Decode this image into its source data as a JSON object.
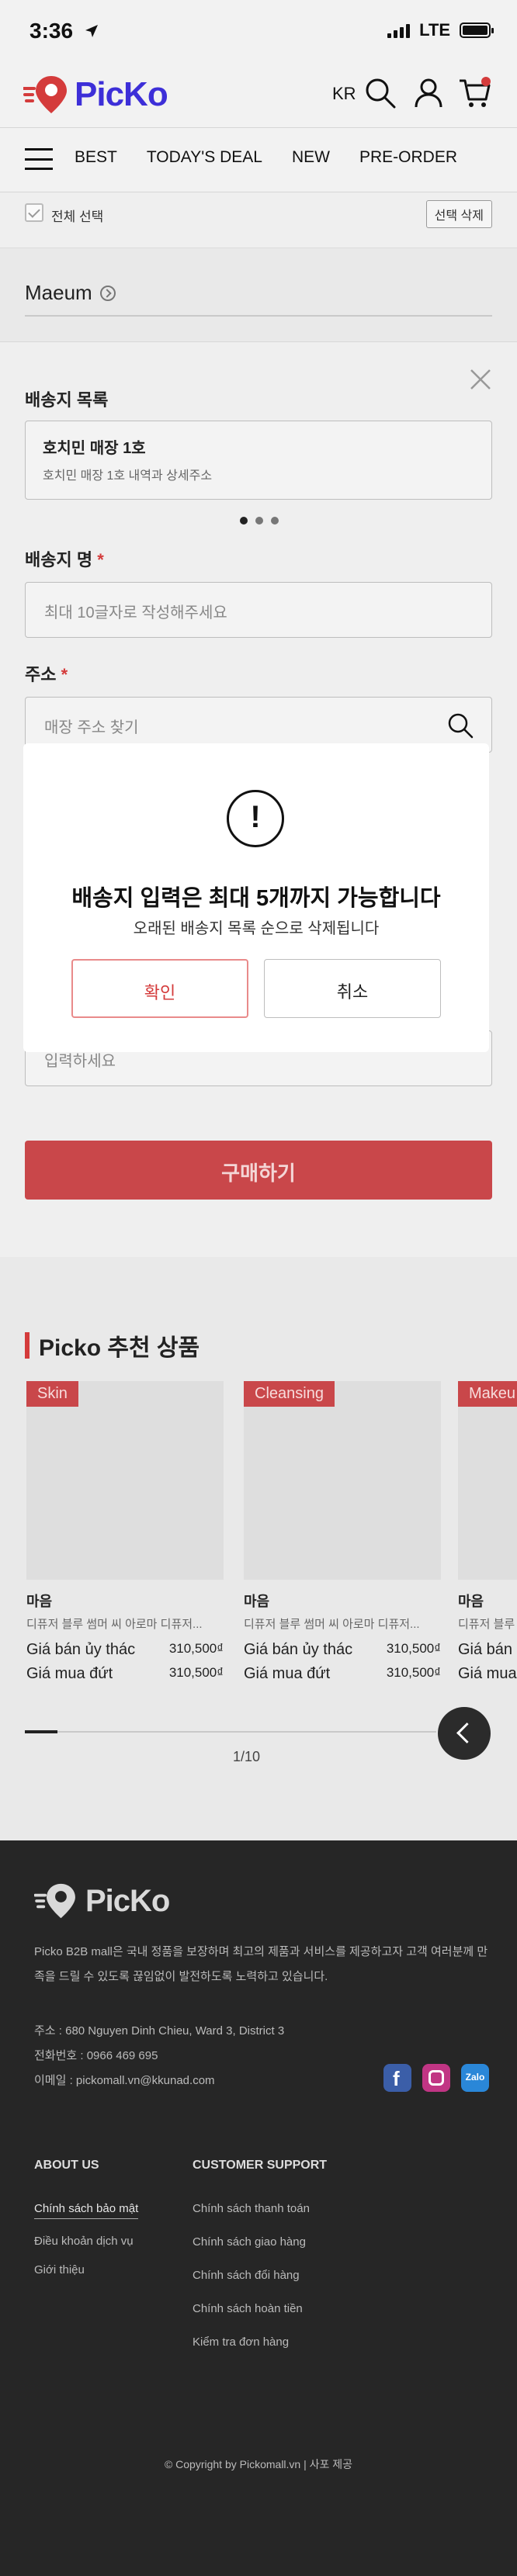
{
  "status_bar": {
    "time": "3:36",
    "network": "LTE"
  },
  "header": {
    "logo_text": "PicKo",
    "lang": "KR",
    "cart_badge": ""
  },
  "nav": {
    "tabs": [
      "BEST",
      "TODAY'S DEAL",
      "NEW",
      "PRE-ORDER"
    ]
  },
  "select_bar": {
    "select_all": "전체 선택",
    "delete_selected": "선택 삭제"
  },
  "store": {
    "name": "Maeum"
  },
  "sheet": {
    "address_list_label": "배송지 목록",
    "card": {
      "title": "호치민 매장 1호",
      "detail": "호치민 매장 1호 내역과 상세주소"
    },
    "name_label": "배송지 명",
    "name_placeholder": "최대 10글자로 작성해주세요",
    "address_label": "주소",
    "address_placeholder": "매장 주소 찾기",
    "extra_placeholder": "입력하세요",
    "buy_label": "구매하기"
  },
  "recommend": {
    "title": "Picko 추천 상품",
    "items": [
      {
        "tag": "Skin",
        "brand": "마음",
        "desc": "디퓨저 블루 썸머 씨 아로마 디퓨저...",
        "price_label": "Giá bán ủy thác",
        "price": "310,500₫",
        "buy_label": "Giá mua đứt",
        "buy_price": "310,500₫"
      },
      {
        "tag": "Cleansing",
        "brand": "마음",
        "desc": "디퓨저 블루 썸머 씨 아로마 디퓨저...",
        "price_label": "Giá bán ủy thác",
        "price": "310,500₫",
        "buy_label": "Giá mua đứt",
        "buy_price": "310,500₫"
      },
      {
        "tag": "Makeu",
        "brand": "마음",
        "desc": "디퓨저 블루 썸머 씨 아로마 디퓨저...",
        "price_label": "Giá bán",
        "price": "",
        "buy_label": "Giá mua",
        "buy_price": ""
      }
    ],
    "pager": "1/10"
  },
  "footer": {
    "logo_text": "PicKo",
    "desc": "Picko B2B mall은 국내 정품을 보장하며 최고의 제품과 서비스를 제공하고자 고객 여러분께 만족을 드릴 수 있도록 끊임없이 발전하도록 노력하고 있습니다.",
    "address": "주소 : 680 Nguyen Dinh Chieu, Ward 3, District 3",
    "phone": "전화번호 : 0966 469 695",
    "email": "이메일 : pickomall.vn@kkunad.com",
    "about_title": "ABOUT US",
    "about_links": [
      "Chính sách bảo mật",
      "Điều khoản dịch vụ",
      "Giới thiệu"
    ],
    "support_title": "CUSTOMER SUPPORT",
    "support_links": [
      "Chính sách thanh toán",
      "Chính sách giao hàng",
      "Chính sách đổi hàng",
      "Chính sách hoàn tiền",
      "Kiểm tra đơn hàng"
    ],
    "copyright": "© Copyright by Pickomall.vn | 사포 제공",
    "zalo": "Zalo"
  },
  "modal": {
    "icon": "!",
    "title": "배송지 입력은 최대 5개까지 가능합니다",
    "subtitle": "오래된 배송지 목록 순으로 삭제됩니다",
    "confirm": "확인",
    "cancel": "취소"
  },
  "colors": {
    "brand": "#3d2fd8",
    "accent": "#d43b3b",
    "footer_bg": "#262626"
  }
}
